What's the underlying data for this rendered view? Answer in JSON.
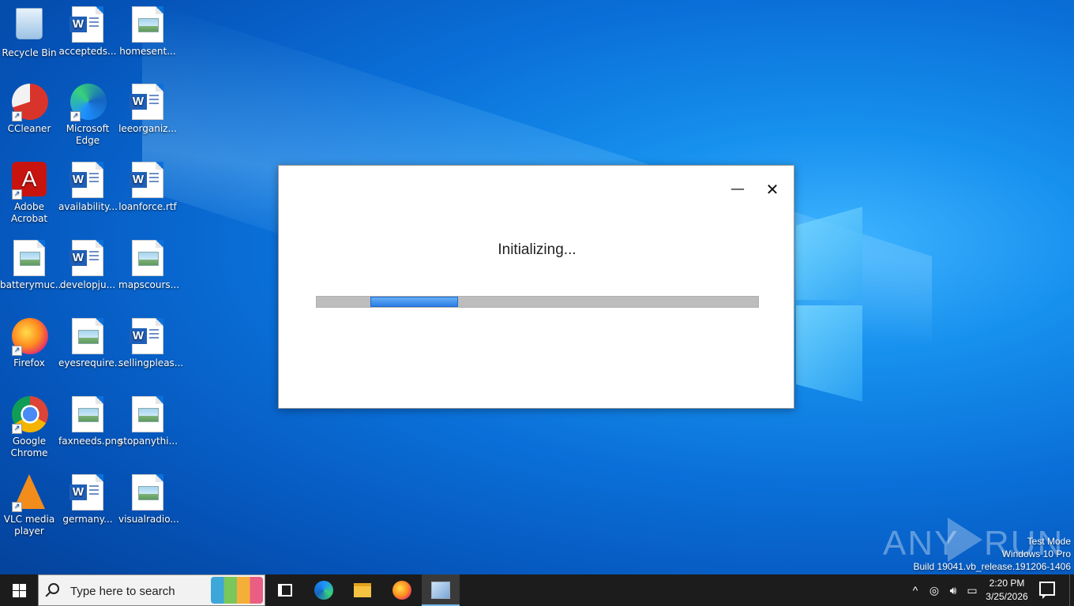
{
  "desktop": {
    "icons": [
      {
        "label": "Recycle Bin",
        "icon": "recycle-bin-icon"
      },
      {
        "label": "accepteds...",
        "icon": "word-document-icon"
      },
      {
        "label": "homesent...",
        "icon": "image-file-icon"
      },
      {
        "label": "CCleaner",
        "icon": "ccleaner-icon"
      },
      {
        "label": "Microsoft Edge",
        "icon": "edge-icon"
      },
      {
        "label": "leeorganiz...",
        "icon": "word-document-icon"
      },
      {
        "label": "Adobe Acrobat",
        "icon": "acrobat-icon"
      },
      {
        "label": "availability...",
        "icon": "word-document-icon"
      },
      {
        "label": "loanforce.rtf",
        "icon": "word-document-icon"
      },
      {
        "label": "batterymuc...",
        "icon": "image-file-icon"
      },
      {
        "label": "developju...",
        "icon": "word-document-icon"
      },
      {
        "label": "mapscours...",
        "icon": "image-file-icon"
      },
      {
        "label": "Firefox",
        "icon": "firefox-icon"
      },
      {
        "label": "eyesrequire...",
        "icon": "image-file-icon"
      },
      {
        "label": "sellingpleas...",
        "icon": "word-document-icon"
      },
      {
        "label": "Google Chrome",
        "icon": "chrome-icon"
      },
      {
        "label": "faxneeds.png",
        "icon": "image-file-icon"
      },
      {
        "label": "stopanythi...",
        "icon": "image-file-icon"
      },
      {
        "label": "VLC media player",
        "icon": "vlc-icon"
      },
      {
        "label": "germany...",
        "icon": "word-document-icon"
      },
      {
        "label": "visualradio...",
        "icon": "image-file-icon"
      }
    ]
  },
  "dialog": {
    "status_text": "Initializing...",
    "minimize_symbol": "—",
    "close_symbol": "✕"
  },
  "watermark": {
    "left": "ANY",
    "right": "RUN"
  },
  "system_info": {
    "line1": "Test Mode",
    "line2": "Windows 10 Pro",
    "line3": "Build 19041.vb_release.191206-1406"
  },
  "taskbar": {
    "search_placeholder": "Type here to search",
    "tray_up": "^",
    "time": "2:20 PM",
    "date": "3/25/2026"
  },
  "colors": {
    "accent": "#2d7fe6",
    "taskbar": "#1c1c1c",
    "desktop": "#0a6fd8"
  }
}
